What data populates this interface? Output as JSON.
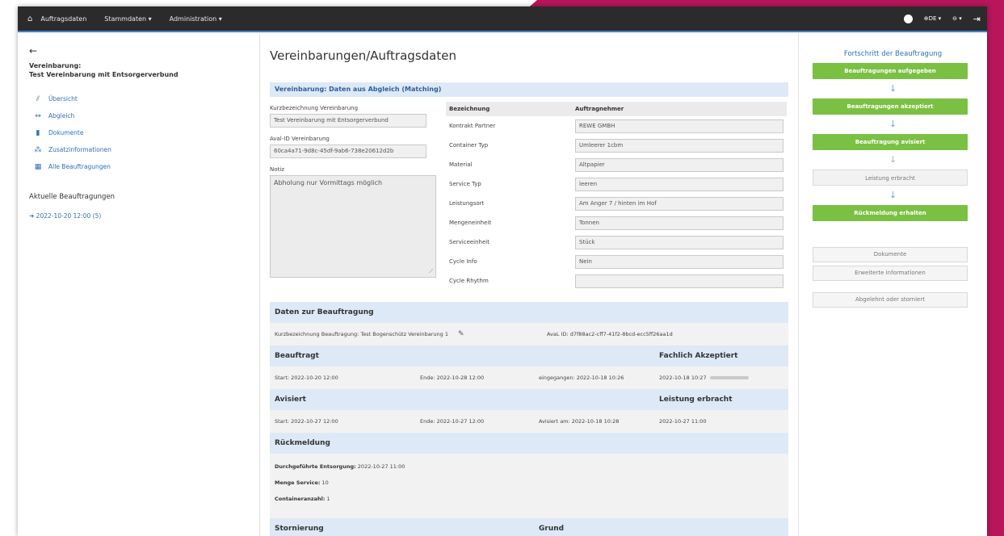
{
  "navbar": {
    "home_icon": "home-icon",
    "items": [
      "Auftragsdaten",
      "Stammdaten ▾",
      "Administration ▾"
    ],
    "lang": "⊕DE ▾",
    "user": "⊖ ▾",
    "logout": "⇥"
  },
  "sidebar": {
    "back": "←",
    "agreement_label": "Vereinbarung:",
    "agreement_name": "Test Vereinbarung mit Entsorgerverbund",
    "links": [
      {
        "icon": "chart-icon",
        "glyph": "📈",
        "label": "Übersicht"
      },
      {
        "icon": "arrows-icon",
        "glyph": "↔",
        "label": "Abgleich"
      },
      {
        "icon": "document-icon",
        "glyph": "▮",
        "label": "Dokumente"
      },
      {
        "icon": "sitemap-icon",
        "glyph": "⁂",
        "label": "Zusatzinformationen"
      },
      {
        "icon": "table-icon",
        "glyph": "▦",
        "label": "Alle Beauftragungen"
      }
    ],
    "current_heading": "Aktuelle Beauftragungen",
    "current_order": "➜ 2022-10-20 12:00 (5)"
  },
  "main": {
    "title": "Vereinbarungen/Auftragsdaten",
    "matching_header": "Vereinbarung: Daten aus Abgleich (Matching)",
    "form_left": {
      "short_label": "Kurzbezeichnung Vereinbarung",
      "short_value": "Test Vereinbarung mit Entsorgerverbund",
      "id_label": "Aval-ID Vereinbarung",
      "id_value": "60ca4a71-9d8c-45df-9ab6-738e20612d2b",
      "note_label": "Notiz",
      "note_value": "Abholung nur Vormittags möglich"
    },
    "table": {
      "col1": "Bezeichnung",
      "col2": "Auftragnehmer",
      "rows": [
        {
          "label": "Kontrakt Partner",
          "value": "REWE GMBH"
        },
        {
          "label": "Container Typ",
          "value": "Umleerer 1cbm"
        },
        {
          "label": "Material",
          "value": "Altpapier"
        },
        {
          "label": "Service Typ",
          "value": "leeren"
        },
        {
          "label": "Leistungsort",
          "value": "Am Anger 7 / hinten im Hof"
        },
        {
          "label": "Mengeneinheit",
          "value": "Tonnen"
        },
        {
          "label": "Serviceeinheit",
          "value": "Stück"
        },
        {
          "label": "Cycle Info",
          "value": "Nein"
        },
        {
          "label": "Cycle Rhythm",
          "value": ""
        }
      ]
    },
    "detail": {
      "header": "Daten zur Beauftragung",
      "short_label": "Kurzbezeichnung Beauftragung:",
      "short_value": "Test Bogenschütz Vereinbarung 1",
      "aval_id": "AvaL ID: d7f88ac2-cff7-41f2-8bcd-ecc5ff26aa1d",
      "beauftragt_header": "Beauftragt",
      "akzeptiert_header": "Fachlich Akzeptiert",
      "beauftragt_start": "Start: 2022-10-20 12:00",
      "beauftragt_end": "Ende: 2022-10-28 12:00",
      "eingegangen": "eingegangen: 2022-10-18 10:26",
      "akzeptiert_date": "2022-10-18 10:27",
      "avisiert_header": "Avisiert",
      "leistung_header": "Leistung erbracht",
      "avisiert_start": "Start: 2022-10-27 12:00",
      "avisiert_end": "Ende: 2022-10-27 12:00",
      "avisiert_am": "Avisiert am: 2022-10-18 10:28",
      "leistung_date": "2022-10-27 11:00",
      "rueckmeldung_header": "Rückmeldung",
      "entsorgung_label": "Durchgeführte Entsorgung:",
      "entsorgung_value": "2022-10-27 11:00",
      "menge_label": "Menge Service:",
      "menge_value": "10",
      "container_label": "Containeranzahl:",
      "container_value": "1",
      "stornierung_header": "Stornierung",
      "grund_header": "Grund"
    }
  },
  "progress": {
    "title": "Fortschritt der Beauftragung",
    "steps": [
      {
        "label": "Beauftragungen aufgegeben",
        "status": "done"
      },
      {
        "label": "Beauftragungen akzeptiert",
        "status": "done"
      },
      {
        "label": "Beauftragung avisiert",
        "status": "done"
      },
      {
        "label": "Leistung erbracht",
        "status": "open"
      },
      {
        "label": "Rückmeldung erhalten",
        "status": "done"
      }
    ],
    "buttons": [
      "Dokumente",
      "Erweiterte Informationen",
      "Abgelehnt oder storniert"
    ],
    "colors": {
      "done": "#7ac043",
      "arrow": "#3f7fc8"
    }
  }
}
